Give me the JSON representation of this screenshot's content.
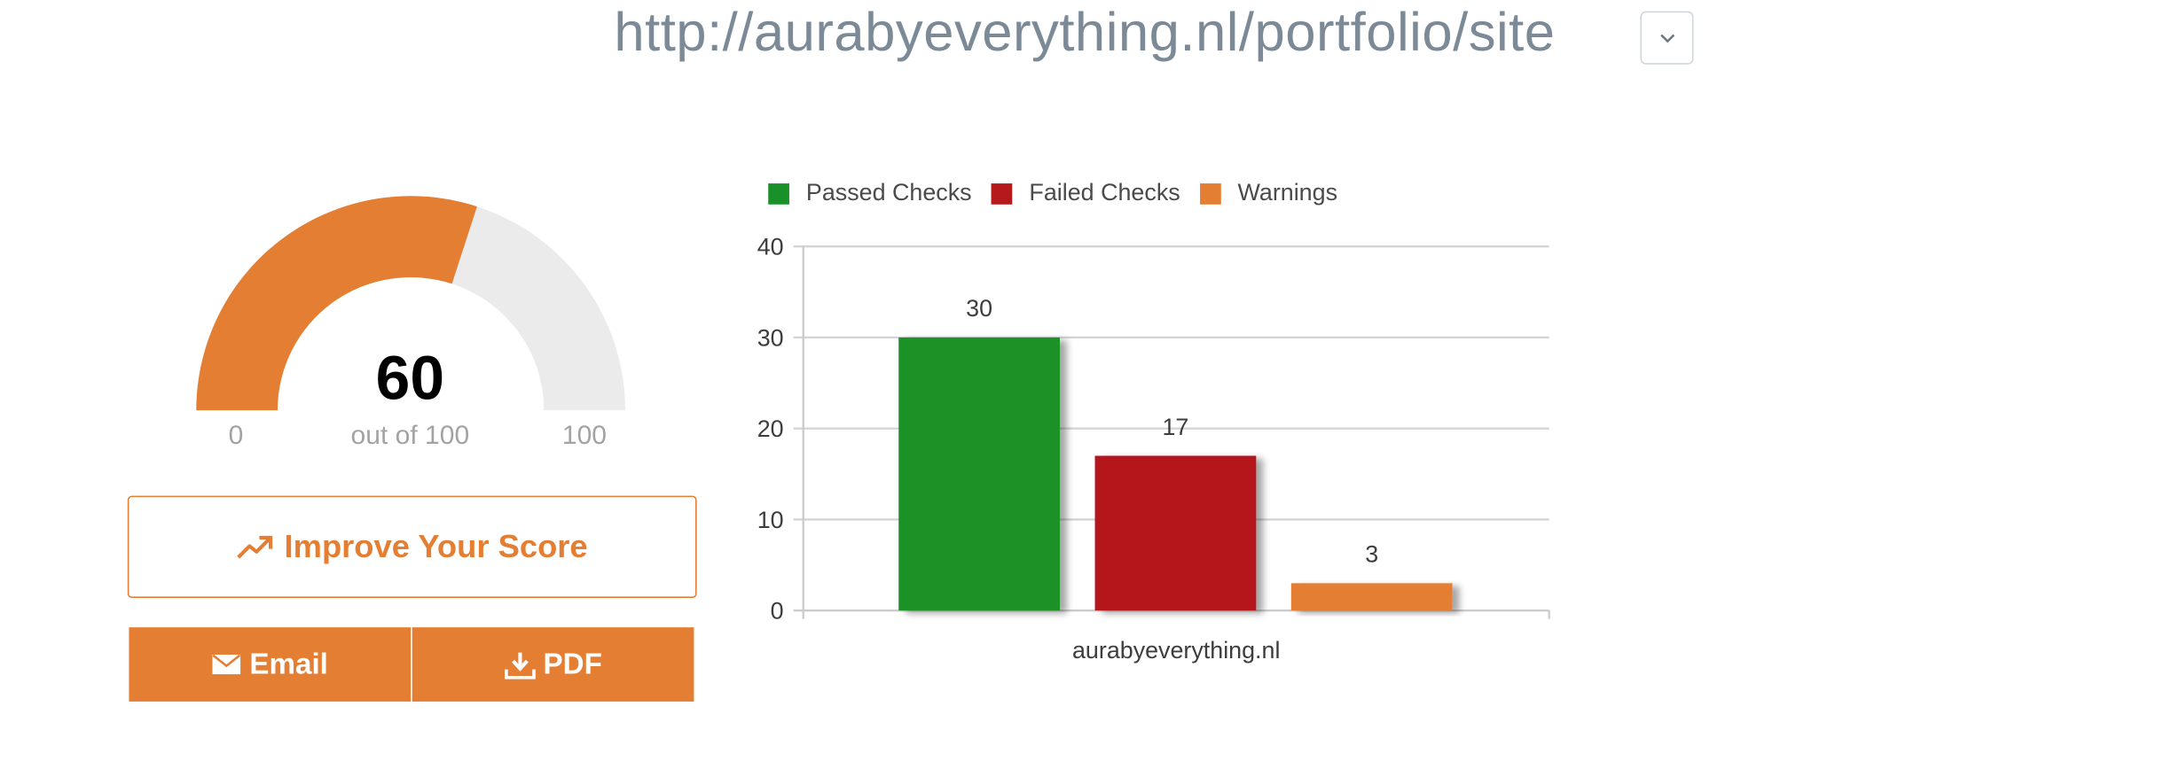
{
  "header": {
    "url": "http://aurabyeverything.nl/portfolio/site"
  },
  "score": {
    "value": "60",
    "subtitle": "out of 100",
    "min": "0",
    "max": "100",
    "fraction": 0.6,
    "fill_color": "#e37e33",
    "track_color": "#ebebeb"
  },
  "actions": {
    "improve_label": "Improve Your Score",
    "email_label": "Email",
    "pdf_label": "PDF",
    "accent_color": "#e37e33"
  },
  "icons": {
    "url_toggle": "chevron-down-icon",
    "improve": "trending-up-icon",
    "email": "envelope-icon",
    "pdf": "download-icon"
  },
  "chart_data": {
    "type": "bar",
    "categories": [
      "aurabyeverything.nl"
    ],
    "series": [
      {
        "name": "Passed Checks",
        "values": [
          30
        ],
        "color": "#1a9128"
      },
      {
        "name": "Failed Checks",
        "values": [
          17
        ],
        "color": "#b5191b"
      },
      {
        "name": "Warnings",
        "values": [
          3
        ],
        "color": "#e37e33"
      }
    ],
    "ylim": [
      0,
      40
    ],
    "yticks": [
      "0",
      "10",
      "20",
      "30",
      "40"
    ],
    "data_labels": [
      "30",
      "17",
      "3"
    ],
    "grid": true,
    "legend_position": "top-left"
  }
}
